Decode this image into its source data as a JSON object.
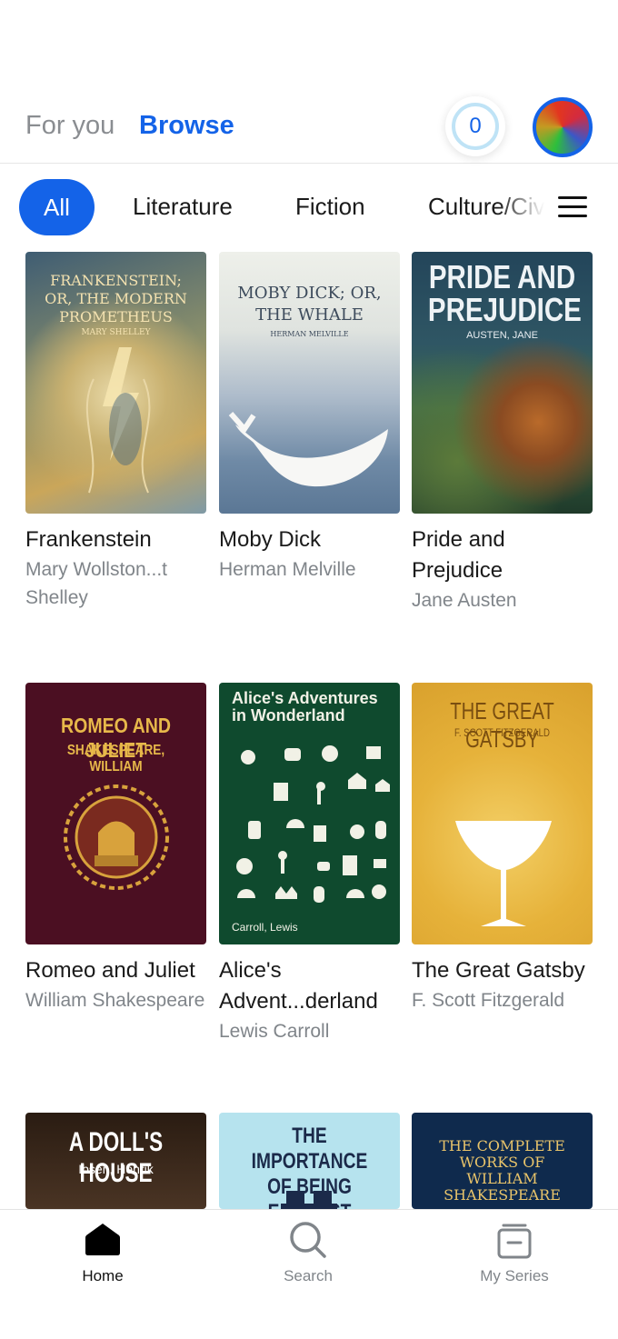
{
  "header": {
    "tabs": [
      "For you",
      "Browse"
    ],
    "coin_count": "0"
  },
  "categories": {
    "items": [
      "All",
      "Literature",
      "Fiction",
      "Culture/Civ"
    ]
  },
  "books": [
    {
      "title": "Frankenstein",
      "author": "Mary Wollston...t Shelley",
      "cover_title": "FRANKENSTEIN; OR, THE MODERN PROMETHEUS",
      "cover_author": "MARY SHELLEY"
    },
    {
      "title": "Moby Dick",
      "author": "Herman Melville",
      "cover_title": "MOBY DICK; OR, THE WHALE",
      "cover_author": "HERMAN MELVILLE"
    },
    {
      "title": "Pride and Prejudice",
      "author": "Jane Austen",
      "cover_title": "PRIDE AND PREJUDICE",
      "cover_author": "AUSTEN, JANE"
    },
    {
      "title": "Romeo and Juliet",
      "author": "William Shakespeare",
      "cover_title": "ROMEO AND JULIET",
      "cover_author": "SHAKESPEARE, WILLIAM"
    },
    {
      "title": "Alice's Advent...derland",
      "author": "Lewis Carroll",
      "cover_title": "Alice's Adventures in Wonderland",
      "cover_author": "Carroll, Lewis"
    },
    {
      "title": "The Great Gatsby",
      "author": "F. Scott Fitzgerald",
      "cover_title": "THE GREAT GATSBY",
      "cover_author": "F. SCOTT FITZGERALD"
    },
    {
      "cover_title": "A DOLL'S HOUSE",
      "cover_author": "Ibsen, Henrik"
    },
    {
      "cover_title": "THE IMPORTANCE OF BEING EARNEST"
    },
    {
      "cover_title": "THE COMPLETE WORKS OF WILLIAM SHAKESPEARE"
    }
  ],
  "bottom_nav": {
    "home": "Home",
    "search": "Search",
    "series": "My Series"
  },
  "colors": {
    "accent": "#1463e8",
    "muted_text": "#80858a"
  }
}
